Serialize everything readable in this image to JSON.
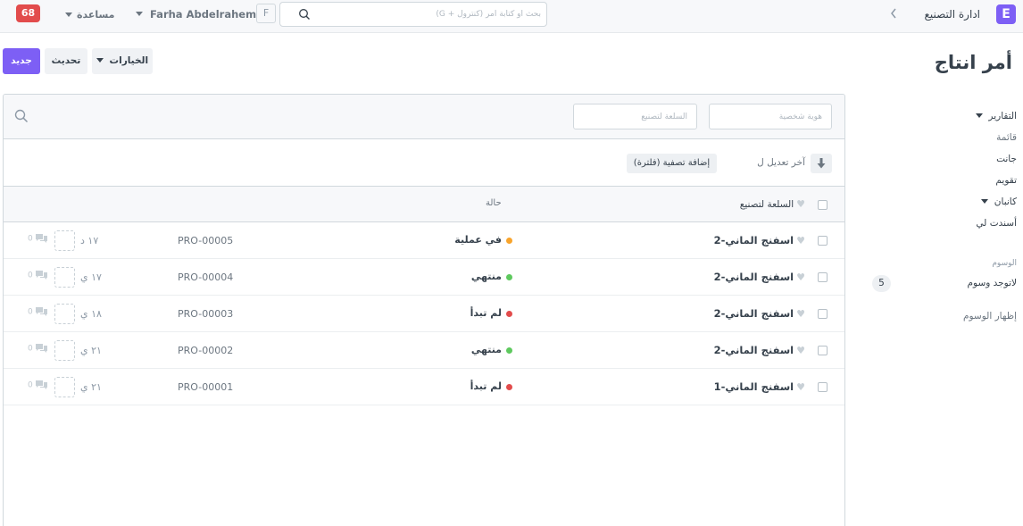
{
  "app": {
    "logo_letter": "E",
    "breadcrumb": "ادارة التصنيع"
  },
  "navbar": {
    "search_placeholder": "بحث أو كتابة أمر (كنترول + G)",
    "avatar_letter": "F",
    "user_name": "Farha Abdelrahem",
    "help_label": "مساعدة",
    "notification_count": "68"
  },
  "page": {
    "title": "أمر انتاج",
    "buttons": {
      "new": "جديد",
      "refresh": "تحديث",
      "options": "الخيارات"
    }
  },
  "sidebar": {
    "reports": "التقارير",
    "list": "قائمة",
    "gantt": "جانت",
    "calendar": "تقويم",
    "kanban": "كانبان",
    "assigned_to_me": "أسندت لي",
    "tags_heading": "الوسوم",
    "no_tags": "لاتوجد وسوم",
    "tag_count": "5",
    "show_tags": "إظهار الوسوم"
  },
  "filters": {
    "id_placeholder": "هوية شخصية",
    "item_placeholder": "السلعة لتصنيع",
    "sort_label": "آخر تعديل ل",
    "add_filter": "إضافة تصفية (فلترة)"
  },
  "list": {
    "col_title": "السلعة لتصنيع",
    "col_status": "حالة",
    "rows": [
      {
        "title": "اسفنج الماني-2",
        "status": "في عملية",
        "status_color": "#f8a42c",
        "id": "PRO-00005",
        "date": "١٧ د",
        "comments": "0"
      },
      {
        "title": "اسفنج الماني-2",
        "status": "منتهي",
        "status_color": "#5ec95e",
        "id": "PRO-00004",
        "date": "١٧ ي",
        "comments": "0"
      },
      {
        "title": "اسفنج الماني-2",
        "status": "لم تبدأ",
        "status_color": "#e24c4c",
        "id": "PRO-00003",
        "date": "١٨ ي",
        "comments": "0"
      },
      {
        "title": "اسفنج الماني-2",
        "status": "منتهي",
        "status_color": "#5ec95e",
        "id": "PRO-00002",
        "date": "٢١ ي",
        "comments": "0"
      },
      {
        "title": "اسفنج الماني-1",
        "status": "لم تبدأ",
        "status_color": "#e24c4c",
        "id": "PRO-00001",
        "date": "٢١ ي",
        "comments": "0"
      }
    ]
  },
  "icons": {
    "logo": "logo-e-icon",
    "breadcrumb": "chevron-left-icon",
    "search": "search-icon",
    "caret": "caret-down-icon",
    "sort": "sort-desc-icon",
    "heart": "heart-icon",
    "comment": "comment-icon"
  },
  "colors": {
    "accent": "#7d5ff5",
    "notification": "#e24c4c"
  }
}
